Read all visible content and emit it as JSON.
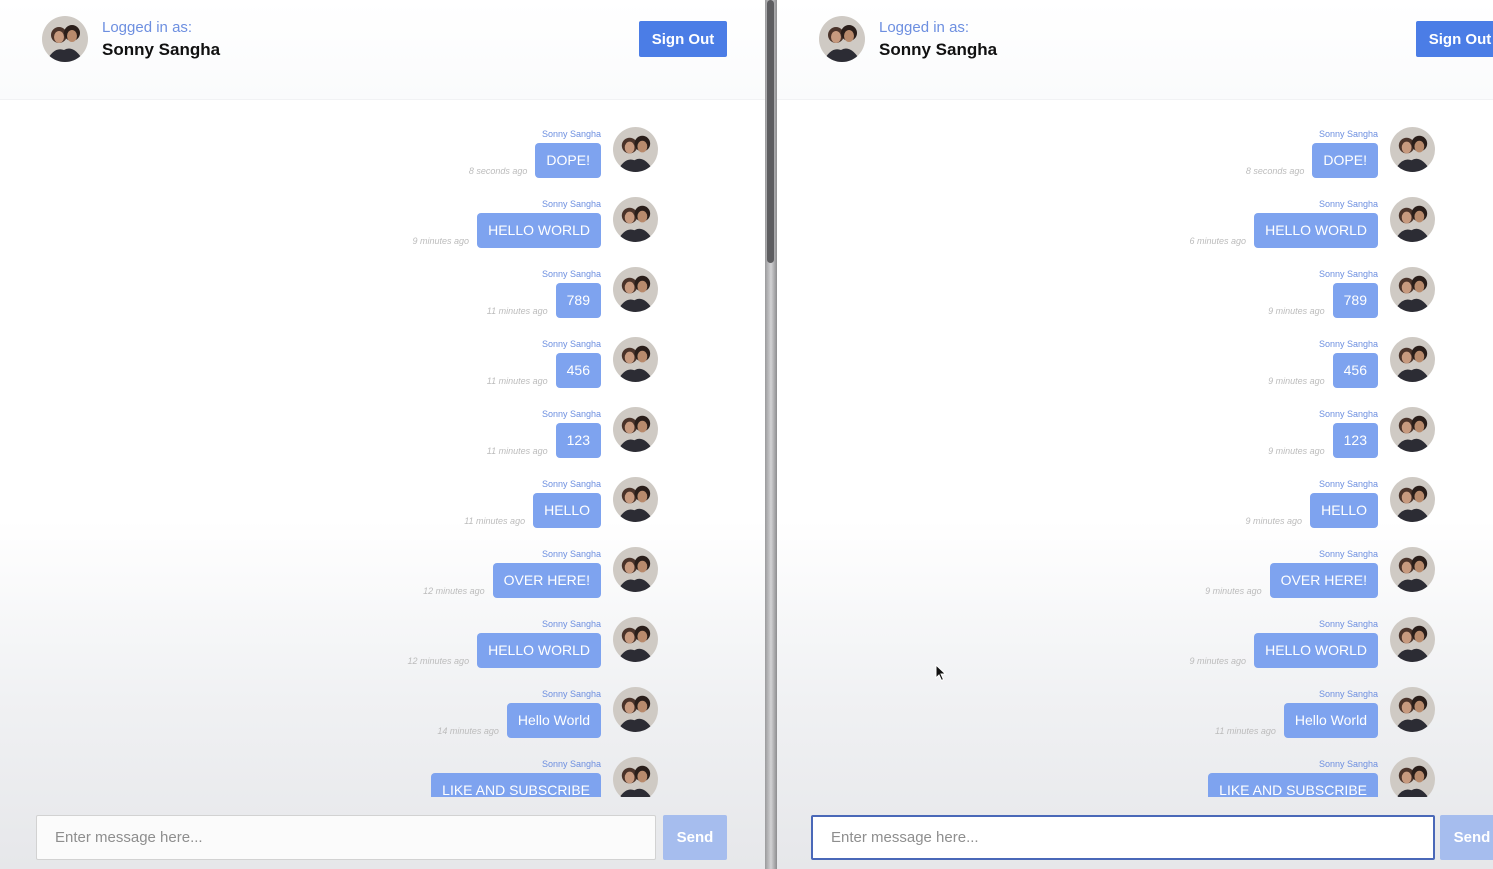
{
  "header": {
    "logged_in_label": "Logged in as:",
    "user_name": "Sonny Sangha",
    "sign_out_label": "Sign Out"
  },
  "composer": {
    "placeholder": "Enter message here...",
    "send_label": "Send"
  },
  "panes": [
    {
      "id": "left",
      "messages": [
        {
          "sender": "Sonny Sangha",
          "text": "DOPE!",
          "time": "8 seconds ago"
        },
        {
          "sender": "Sonny Sangha",
          "text": "HELLO WORLD",
          "time": "9 minutes ago"
        },
        {
          "sender": "Sonny Sangha",
          "text": "789",
          "time": "11 minutes ago"
        },
        {
          "sender": "Sonny Sangha",
          "text": "456",
          "time": "11 minutes ago"
        },
        {
          "sender": "Sonny Sangha",
          "text": "123",
          "time": "11 minutes ago"
        },
        {
          "sender": "Sonny Sangha",
          "text": "HELLO",
          "time": "11 minutes ago"
        },
        {
          "sender": "Sonny Sangha",
          "text": "OVER HERE!",
          "time": "12 minutes ago"
        },
        {
          "sender": "Sonny Sangha",
          "text": "HELLO WORLD",
          "time": "12 minutes ago"
        },
        {
          "sender": "Sonny Sangha",
          "text": "Hello World",
          "time": "14 minutes ago"
        },
        {
          "sender": "Sonny Sangha",
          "text": "LIKE AND SUBSCRIBE",
          "time": ""
        }
      ]
    },
    {
      "id": "right",
      "messages": [
        {
          "sender": "Sonny Sangha",
          "text": "DOPE!",
          "time": "8 seconds ago"
        },
        {
          "sender": "Sonny Sangha",
          "text": "HELLO WORLD",
          "time": "6 minutes ago"
        },
        {
          "sender": "Sonny Sangha",
          "text": "789",
          "time": "9 minutes ago"
        },
        {
          "sender": "Sonny Sangha",
          "text": "456",
          "time": "9 minutes ago"
        },
        {
          "sender": "Sonny Sangha",
          "text": "123",
          "time": "9 minutes ago"
        },
        {
          "sender": "Sonny Sangha",
          "text": "HELLO",
          "time": "9 minutes ago"
        },
        {
          "sender": "Sonny Sangha",
          "text": "OVER HERE!",
          "time": "9 minutes ago"
        },
        {
          "sender": "Sonny Sangha",
          "text": "HELLO WORLD",
          "time": "9 minutes ago"
        },
        {
          "sender": "Sonny Sangha",
          "text": "Hello World",
          "time": "11 minutes ago"
        },
        {
          "sender": "Sonny Sangha",
          "text": "LIKE AND SUBSCRIBE",
          "time": ""
        }
      ]
    }
  ],
  "colors": {
    "accent": "#4b7de6",
    "bubble": "#7ea3ef",
    "label": "#6d8fe0",
    "send_disabled": "#a6bdee"
  }
}
